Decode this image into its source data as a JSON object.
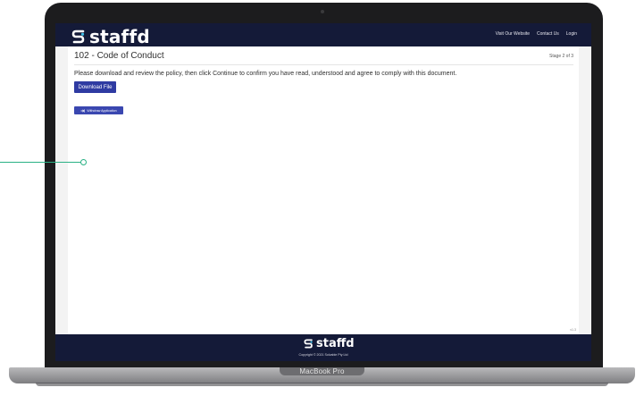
{
  "device_label": "MacBook Pro",
  "app": {
    "brand_name": "staffd",
    "nav": [
      "Visit Our Website",
      "Contact Us",
      "Login"
    ]
  },
  "page": {
    "title": "102 - Code of Conduct",
    "stage": "Stage 2 of 3",
    "instructions": "Please download and review the policy, then click Continue to confirm you have read, understood and agree to comply with this document.",
    "download_label": "Download File",
    "withdraw_label": "Withdraw Application",
    "version": "v1.3"
  },
  "footer": {
    "brand_name": "staffd",
    "copyright": "Copyright © 2021 Solvable Pty Ltd"
  },
  "colors": {
    "header_bg": "#141a38",
    "button_bg": "#2f3ba2",
    "accent_cyan": "#3fc1ea",
    "callout_green": "#2ab185"
  },
  "icons": [
    "staffd-logo-icon",
    "withdraw-icon"
  ]
}
